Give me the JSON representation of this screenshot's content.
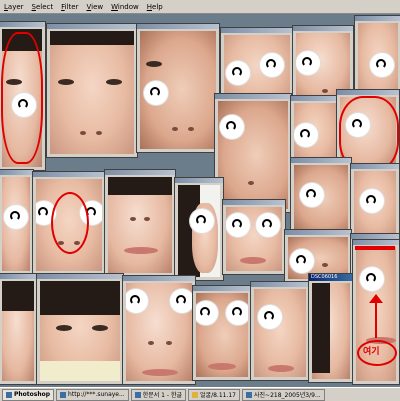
{
  "menubar": {
    "items": [
      "Layer",
      "Select",
      "Filter",
      "View",
      "Window",
      "Help"
    ]
  },
  "active_window": {
    "title": "DSC06016"
  },
  "annotation": {
    "label": "여기"
  },
  "taskbar": {
    "items": [
      "Photoshop",
      "http://***.sunaye...",
      "한문서 1 - 한글",
      "얼굴/8.11.17",
      "사진~218_2005년3/9..."
    ]
  },
  "colors": {
    "annotation_red": "#e00000",
    "menubar_bg": "#d4d0c8",
    "desktop_bg": "#6b7d8a"
  }
}
